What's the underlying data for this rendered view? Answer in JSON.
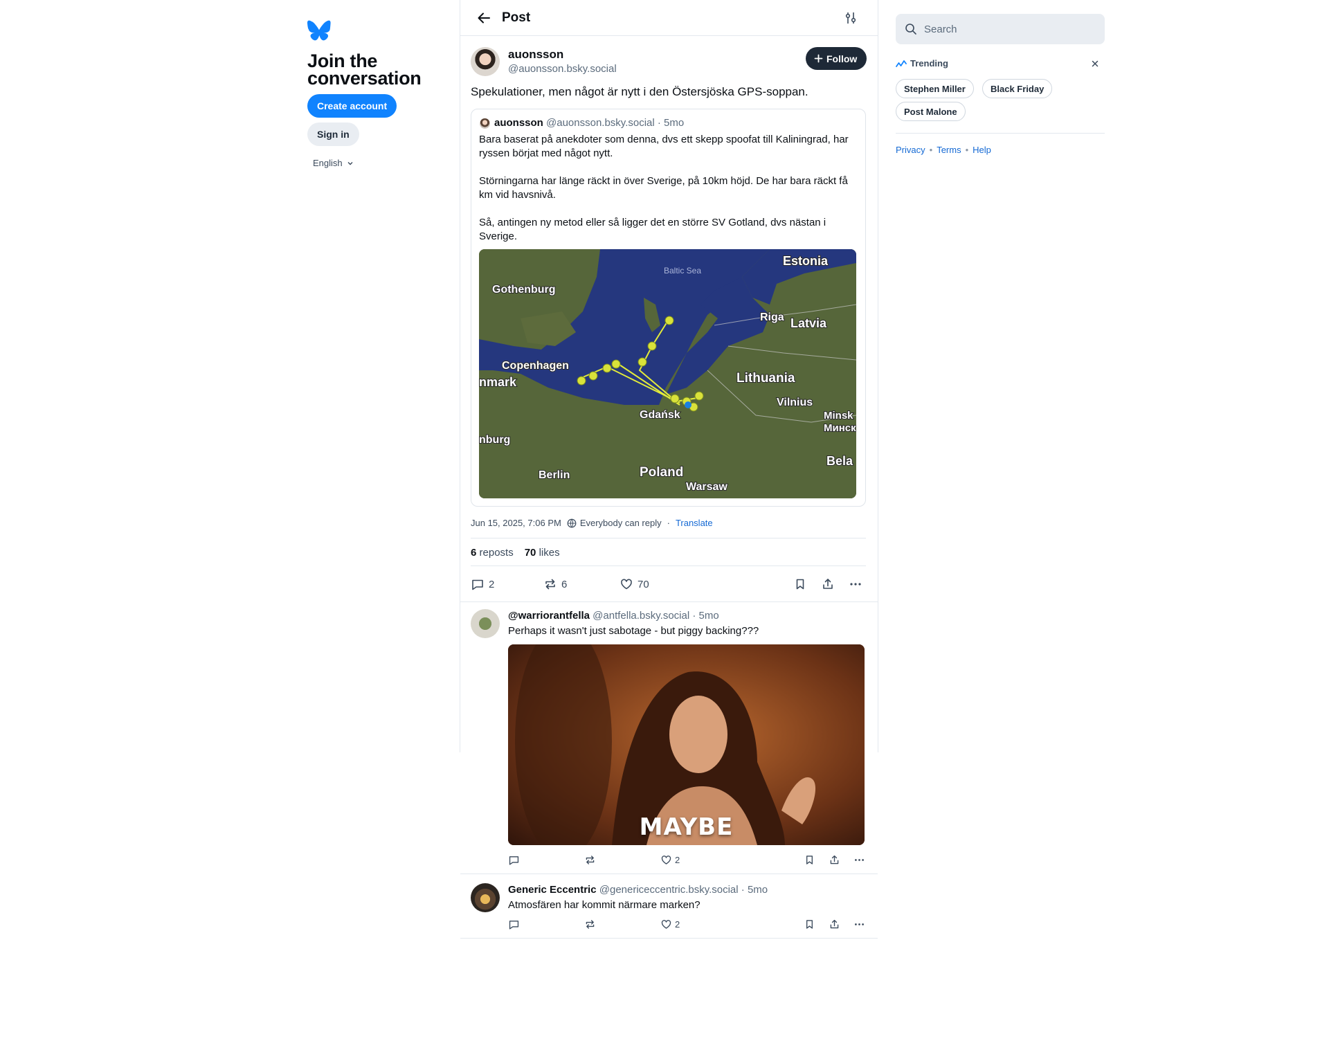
{
  "left": {
    "join_title": "Join the conversation",
    "create_account": "Create account",
    "sign_in": "Sign in",
    "language": "English"
  },
  "header": {
    "title": "Post"
  },
  "post": {
    "author_name": "auonsson",
    "author_handle": "@auonsson.bsky.social",
    "follow_label": "Follow",
    "text": "Spekulationer, men något är nytt i den Östersjöska GPS-soppan.",
    "quote": {
      "author_name": "auonsson",
      "author_meta": "@auonsson.bsky.social · 5mo",
      "paragraphs": [
        "Bara baserat på anekdoter som denna, dvs ett skepp spoofat till Kaliningrad, har ryssen börjat med något nytt.",
        "Störningarna har länge räckt in över Sverige, på 10km höjd. De har bara räckt få km vid havsnivå.",
        "Så, antingen ny metod eller så ligger det en större SV Gotland, dvs nästan i Sverige."
      ],
      "map_labels": {
        "baltic_sea": "Baltic Sea",
        "estonia": "Estonia",
        "gothenburg": "Gothenburg",
        "riga": "Riga",
        "latvia": "Latvia",
        "copenhagen": "Copenhagen",
        "denmark": "nmark",
        "lithuania": "Lithuania",
        "vilnius": "Vilnius",
        "minsk": "Minsk",
        "minsk_cyr": "Минск",
        "gdansk": "Gdańsk",
        "hamburg": "nburg",
        "bela": "Bela",
        "berlin": "Berlin",
        "poland": "Poland",
        "warsaw": "Warsaw"
      }
    },
    "timestamp": "Jun 15, 2025, 7:06 PM",
    "reply_setting": "Everybody can reply",
    "translate": "Translate",
    "reposts_count": "6",
    "reposts_label": "reposts",
    "likes_count": "70",
    "likes_label": "likes",
    "actions": {
      "replies": "2",
      "reposts": "6",
      "likes": "70"
    }
  },
  "replies": [
    {
      "name": "@warriorantfella",
      "meta": "@antfella.bsky.social · 5mo",
      "text": "Perhaps it wasn't just sabotage - but piggy backing???",
      "gif_caption": "MAYBE",
      "likes": "2"
    },
    {
      "name": "Generic Eccentric",
      "meta": "@genericeccentric.bsky.social · 5mo",
      "text": "Atmosfären har kommit närmare marken?",
      "likes": "2"
    }
  ],
  "right": {
    "search_placeholder": "Search",
    "trending_label": "Trending",
    "trends": [
      "Stephen Miller",
      "Black Friday",
      "Post Malone"
    ],
    "footer": {
      "privacy": "Privacy",
      "terms": "Terms",
      "help": "Help"
    }
  },
  "colors": {
    "accent": "#1083fe",
    "link": "#1469d4",
    "follow_bg": "#1e2937"
  }
}
